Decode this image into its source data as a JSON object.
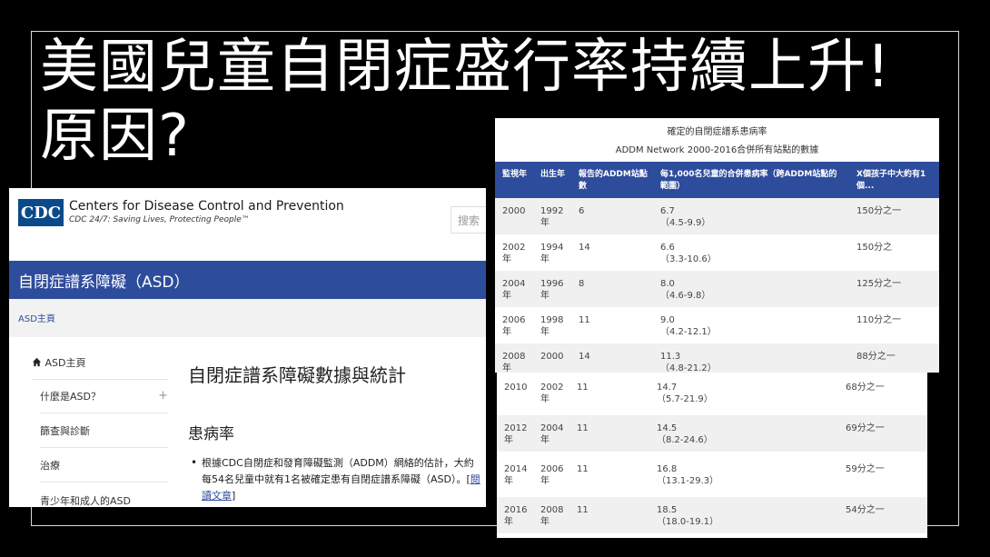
{
  "slide": {
    "title_line1": "美國兒童自閉症盛行率持續上升!",
    "title_line2": "原因?"
  },
  "cdc": {
    "logo_text": "CDC",
    "org_name": "Centers for Disease Control and Prevention",
    "tagline": "CDC 24/7: Saving Lives, Protecting People™",
    "search_placeholder": "搜索",
    "section_title": "自閉症譜系障礙（ASD）",
    "breadcrumb": "ASD主頁",
    "nav": [
      {
        "label": "ASD主頁",
        "icon": "home-icon"
      },
      {
        "label": "什麼是ASD？",
        "expand": "+"
      },
      {
        "label": "篩查與診斷"
      },
      {
        "label": "治療"
      },
      {
        "label": "青少年和成人的ASD"
      }
    ],
    "page_heading": "自閉症譜系障礙數據與統計",
    "subheading": "患病率",
    "paragraph": "根據CDC自閉症和發育障礙監測（ADDM）網絡的估計，大約每54名兒童中就有1名被確定患有自閉症譜系障礙（ASD）。[",
    "link_text": "閱讀文章",
    "paragraph_end": "]"
  },
  "table": {
    "caption1": "確定的自閉症譜系患病率",
    "caption2": "ADDM Network 2000-2016合併所有站點的數據",
    "headers": [
      "監視年",
      "出生年",
      "報告的ADDM站點數",
      "每1,000名兒童的合併患病率（跨ADDM站點的範圍）",
      "X個孩子中大約有1個..."
    ],
    "rows": [
      {
        "year": "2000",
        "birth": "1992年",
        "sites": "6",
        "rate": "6.7",
        "range": "（4.5-9.9）",
        "ratio": "150分之一"
      },
      {
        "year": "2002年",
        "birth": "1994年",
        "sites": "14",
        "rate": "6.6",
        "range": "（3.3-10.6）",
        "ratio": "150分之"
      },
      {
        "year": "2004年",
        "birth": "1996年",
        "sites": "8",
        "rate": "8.0",
        "range": "（4.6-9.8）",
        "ratio": "125分之一"
      },
      {
        "year": "2006年",
        "birth": "1998年",
        "sites": "11",
        "rate": "9.0",
        "range": "（4.2-12.1）",
        "ratio": "110分之一"
      },
      {
        "year": "2008年",
        "birth": "2000",
        "sites": "14",
        "rate": "11.3",
        "range": "（4.8-21.2）",
        "ratio": "88分之一"
      },
      {
        "year": "2010",
        "birth": "2002年",
        "sites": "11",
        "rate": "14.7",
        "range": "（5.7-21.9）",
        "ratio": "68分之一"
      },
      {
        "year": "2012年",
        "birth": "2004年",
        "sites": "11",
        "rate": "14.5",
        "range": "（8.2-24.6）",
        "ratio": "69分之一"
      },
      {
        "year": "2014年",
        "birth": "2006年",
        "sites": "11",
        "rate": "16.8",
        "range": "（13.1-29.3）",
        "ratio": "59分之一"
      },
      {
        "year": "2016年",
        "birth": "2008年",
        "sites": "11",
        "rate": "18.5",
        "range": "（18.0-19.1）",
        "ratio": "54分之一"
      }
    ]
  },
  "colors": {
    "accent": "#2e4c9c",
    "background": "#000000"
  }
}
